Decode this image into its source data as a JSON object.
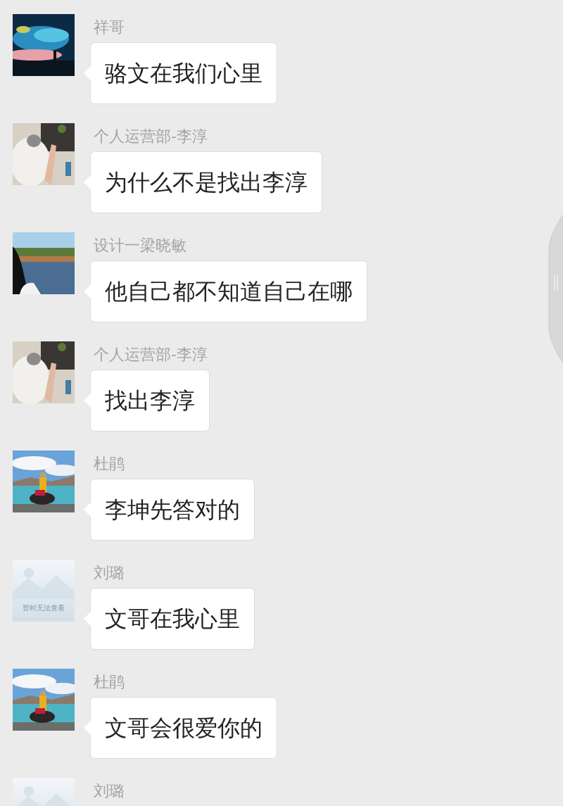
{
  "messages": [
    {
      "sender": "祥哥",
      "text": "骆文在我们心里"
    },
    {
      "sender": "个人运营部-李淳",
      "text": "为什么不是找出李淳"
    },
    {
      "sender": "设计一梁晓敏",
      "text": "他自己都不知道自己在哪"
    },
    {
      "sender": "个人运营部-李淳",
      "text": "找出李淳"
    },
    {
      "sender": "杜鹃",
      "text": "李坤先答对的"
    },
    {
      "sender": "刘璐",
      "avatar": {
        "kind": "unavailable",
        "text": "暂时无法查看"
      },
      "text": "文哥在我心里"
    },
    {
      "sender": "杜鹃",
      "text": "文哥会很爱你的"
    },
    {
      "sender": "刘璐",
      "avatar": {
        "kind": "unavailable"
      }
    }
  ]
}
